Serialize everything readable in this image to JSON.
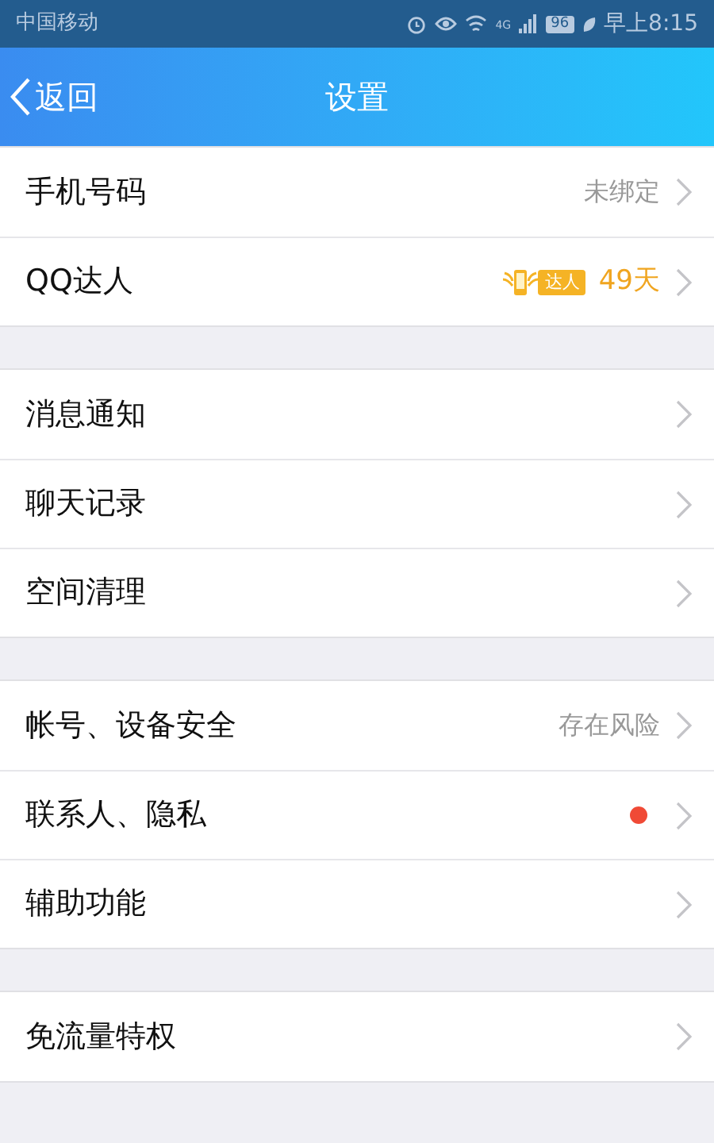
{
  "status_bar": {
    "carrier": "中国移动",
    "network": "4G",
    "battery": "96",
    "time": "早上8:15"
  },
  "nav_bar": {
    "back": "返回",
    "title": "设置"
  },
  "groups": [
    {
      "rows": [
        {
          "kind": "value",
          "label": "手机号码",
          "value": "未绑定"
        },
        {
          "kind": "badge",
          "label": "QQ达人",
          "badge": "达人",
          "value": "49天"
        }
      ]
    },
    {
      "rows": [
        {
          "kind": "plain",
          "label": "消息通知"
        },
        {
          "kind": "plain",
          "label": "聊天记录"
        },
        {
          "kind": "plain",
          "label": "空间清理"
        }
      ]
    },
    {
      "rows": [
        {
          "kind": "value",
          "label": "帐号、设备安全",
          "value": "存在风险"
        },
        {
          "kind": "dot",
          "label": "联系人、隐私",
          "color": "#f04a36"
        },
        {
          "kind": "plain",
          "label": "辅助功能"
        }
      ]
    },
    {
      "rows": [
        {
          "kind": "plain",
          "label": "免流量特权"
        }
      ]
    }
  ]
}
